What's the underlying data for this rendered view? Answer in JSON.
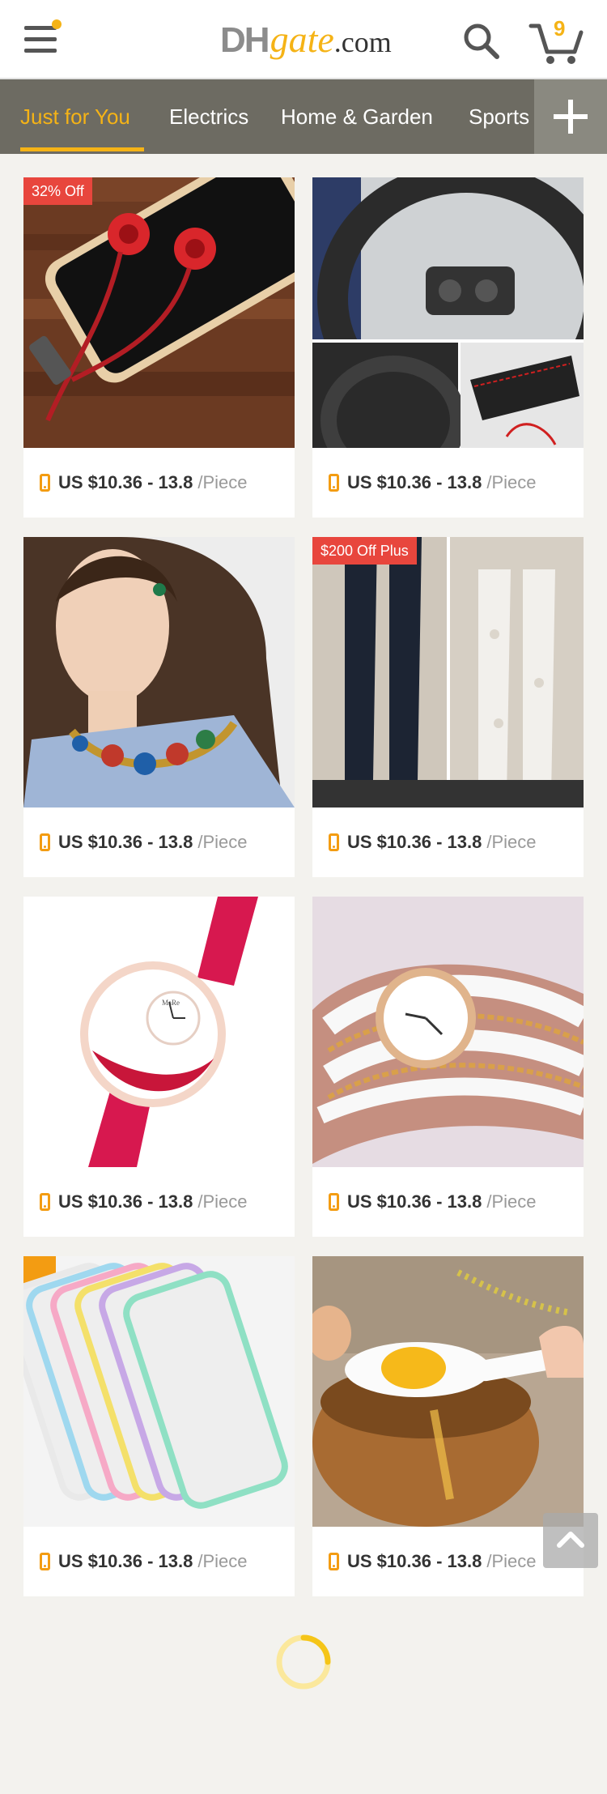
{
  "header": {
    "logo_dh": "DH",
    "logo_gate": "gate",
    "logo_com": ".com",
    "cart_count": "9"
  },
  "tabs": [
    {
      "label": "Just for You",
      "active": true
    },
    {
      "label": "Electrics",
      "active": false
    },
    {
      "label": "Home & Garden",
      "active": false
    },
    {
      "label": "Sports",
      "active": false
    }
  ],
  "colors": {
    "accent": "#f5b316",
    "tabbar": "#6d6b62",
    "badge": "#e8463d",
    "price_icon": "#f39c12"
  },
  "products": [
    {
      "name": "red earphones",
      "badge": "32% Off",
      "price": "US $10.36 - 13.8",
      "unit": "/Piece"
    },
    {
      "name": "steering wheel cover",
      "badge": "",
      "price": "US $10.36 - 13.8",
      "unit": "/Piece"
    },
    {
      "name": "statement necklace",
      "badge": "",
      "price": "US $10.36 - 13.8",
      "unit": "/Piece"
    },
    {
      "name": "lace leggings",
      "badge": "$200 Off Plus",
      "price": "US $10.36 - 13.8",
      "unit": "/Piece"
    },
    {
      "name": "pink wrist watch",
      "badge": "",
      "price": "US $10.36 - 13.8",
      "unit": "/Piece"
    },
    {
      "name": "white bracelet watch",
      "badge": "",
      "price": "US $10.36 - 13.8",
      "unit": "/Piece"
    },
    {
      "name": "phone bumper cases",
      "badge": "",
      "price": "US $10.36 - 13.8",
      "unit": "/Piece"
    },
    {
      "name": "egg separator",
      "badge": "",
      "price": "US $10.36 - 13.8",
      "unit": "/Piece"
    }
  ],
  "watch_brand": "MaRe",
  "icons": {
    "menu": "menu-icon",
    "search": "search-icon",
    "cart": "cart-icon",
    "add": "plus-icon",
    "back_to_top": "chevron-up-icon",
    "loading": "spinner-icon"
  }
}
